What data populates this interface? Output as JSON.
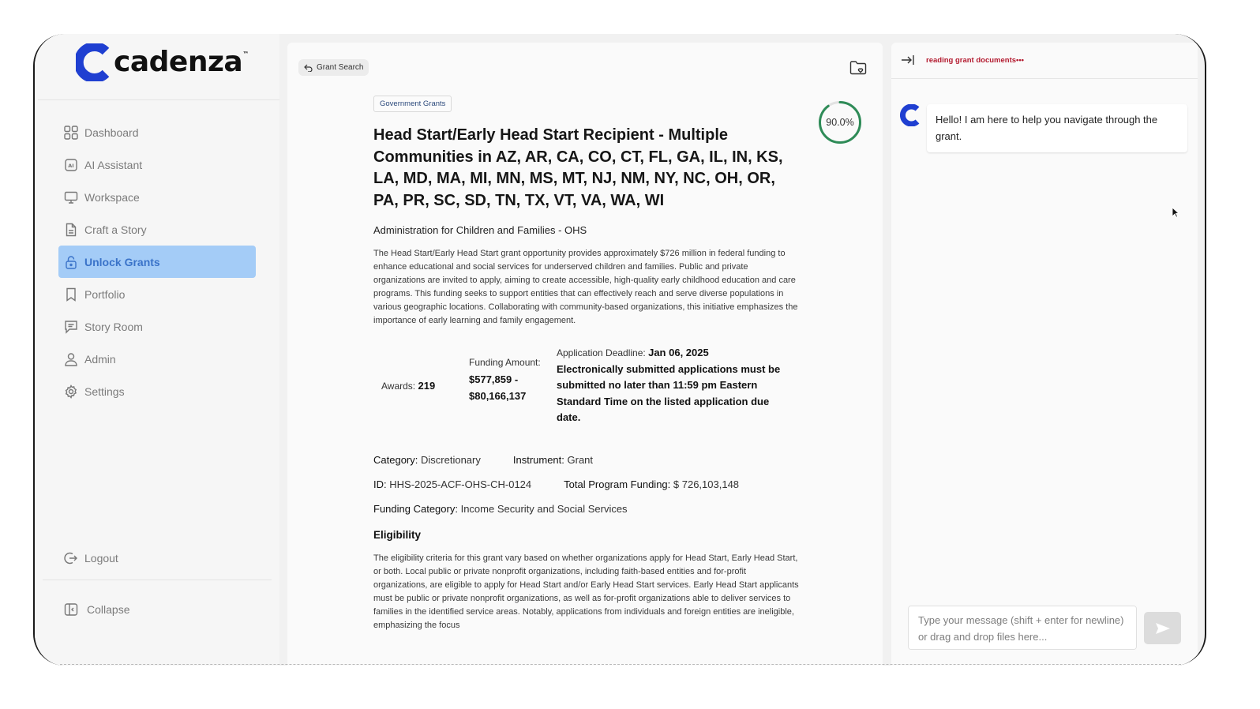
{
  "brand": {
    "name": "cadenza",
    "trademark": "™",
    "color": "#1f3fd1"
  },
  "sidebar": {
    "items": [
      {
        "label": "Dashboard",
        "icon": "grid-icon"
      },
      {
        "label": "AI Assistant",
        "icon": "ai-chip-icon"
      },
      {
        "label": "Workspace",
        "icon": "monitor-icon"
      },
      {
        "label": "Craft a Story",
        "icon": "document-icon"
      },
      {
        "label": "Unlock Grants",
        "icon": "unlock-icon",
        "active": true
      },
      {
        "label": "Portfolio",
        "icon": "bookmark-icon"
      },
      {
        "label": "Story Room",
        "icon": "chat-square-icon"
      },
      {
        "label": "Admin",
        "icon": "user-icon"
      },
      {
        "label": "Settings",
        "icon": "gear-icon"
      }
    ],
    "logout_label": "Logout",
    "collapse_label": "Collapse",
    "active_color": "#a4ccf7"
  },
  "grant": {
    "back_label": "Grant Search",
    "tag": "Government Grants",
    "match_score": "90.0%",
    "match_value": 0.9,
    "title": "Head Start/Early Head Start Recipient - Multiple Communities in AZ, AR, CA, CO, CT, FL, GA, IL, IN, KS, LA, MD, MA, MI, MN, MS, MT, NJ, NM, NY, NC, OH, OR, PA, PR, SC, SD, TN, TX, VT, VA, WA, WI",
    "agency": "Administration for Children and Families - OHS",
    "description": "The Head Start/Early Head Start grant opportunity provides approximately $726 million in federal funding to enhance educational and social services for underserved children and families. Public and private organizations are invited to apply, aiming to create accessible, high-quality early childhood education and care programs. This funding seeks to support entities that can effectively reach and serve diverse populations in various geographic locations. Collaborating with community-based organizations, this initiative emphasizes the importance of early learning and family engagement.",
    "awards_label": "Awards:",
    "awards_value": "219",
    "funding_label": "Funding Amount:",
    "funding_value": "$577,859 - $80,166,137",
    "deadline_label": "Application Deadline:",
    "deadline_value": "Jan 06, 2025",
    "deadline_note": "Electronically submitted applications must be submitted no later than 11:59 pm Eastern Standard Time on the listed application due date.",
    "category_label": "Category:",
    "category_value": "Discretionary",
    "instrument_label": "Instrument:",
    "instrument_value": "Grant",
    "id_label": "ID:",
    "id_value": "HHS-2025-ACF-OHS-CH-0124",
    "total_label": "Total Program Funding:",
    "total_value": "$ 726,103,148",
    "funding_category_label": "Funding Category:",
    "funding_category_value": "Income Security and Social Services",
    "eligibility_heading": "Eligibility",
    "eligibility_text": "The eligibility criteria for this grant vary based on whether organizations apply for Head Start, Early Head Start, or both. Local public or private nonprofit organizations, including faith-based entities and for-profit organizations, are eligible to apply for Head Start and/or Early Head Start services. Early Head Start applicants must be public or private nonprofit organizations, as well as for-profit organizations able to deliver services to families in the identified service areas. Notably, applications from individuals and foreign entities are ineligible, emphasizing the focus",
    "score_color": "#2e8b57"
  },
  "chat": {
    "status": "reading grant documents•••",
    "status_color": "#b3192e",
    "greeting": "Hello! I am here to help you navigate through the grant.",
    "input_placeholder": "Type your message (shift + enter for newline) or drag and drop files here..."
  }
}
